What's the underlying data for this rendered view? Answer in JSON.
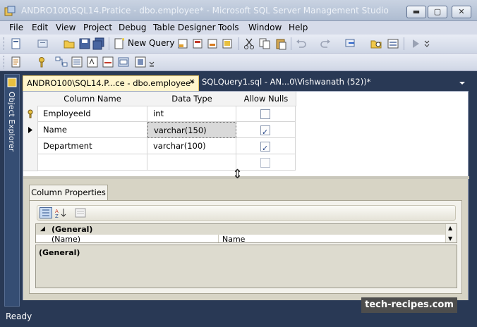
{
  "window": {
    "title": "ANDRO100\\SQL14.Pratice - dbo.employee* - Microsoft SQL Server Management Studio",
    "minimize": "▬",
    "maximize": "▢",
    "close": "✕"
  },
  "menu": [
    "File",
    "Edit",
    "View",
    "Project",
    "Debug",
    "Table Designer",
    "Tools",
    "Window",
    "Help"
  ],
  "toolbar": {
    "new_query_label": "New Query"
  },
  "object_explorer": {
    "label": "Object Explorer"
  },
  "tabs": [
    {
      "label": "ANDRO100\\SQL14.P...ce - dbo.employee*",
      "close": "✕",
      "active": true
    },
    {
      "label": "SQLQuery1.sql - AN...0\\Vishwanath (52))*",
      "active": false
    }
  ],
  "grid": {
    "headers": [
      "Column Name",
      "Data Type",
      "Allow Nulls"
    ],
    "rows": [
      {
        "name": "EmployeeId",
        "type": "int",
        "allow_nulls": false,
        "primary_key": true
      },
      {
        "name": "Name",
        "type": "varchar(150)",
        "allow_nulls": true,
        "current": true
      },
      {
        "name": "Department",
        "type": "varchar(100)",
        "allow_nulls": true
      },
      {
        "name": "",
        "type": "",
        "allow_nulls": false
      }
    ]
  },
  "column_properties": {
    "tab_label": "Column Properties",
    "category": "(General)",
    "row_name": "(Name)",
    "row_value": "Name",
    "description": "(General)"
  },
  "status": {
    "text": "Ready"
  },
  "watermark": "tech-recipes.com",
  "colors": {
    "frame": "#293955",
    "active_tab": "#fff5cc",
    "props_bg": "#d7d4c5"
  }
}
